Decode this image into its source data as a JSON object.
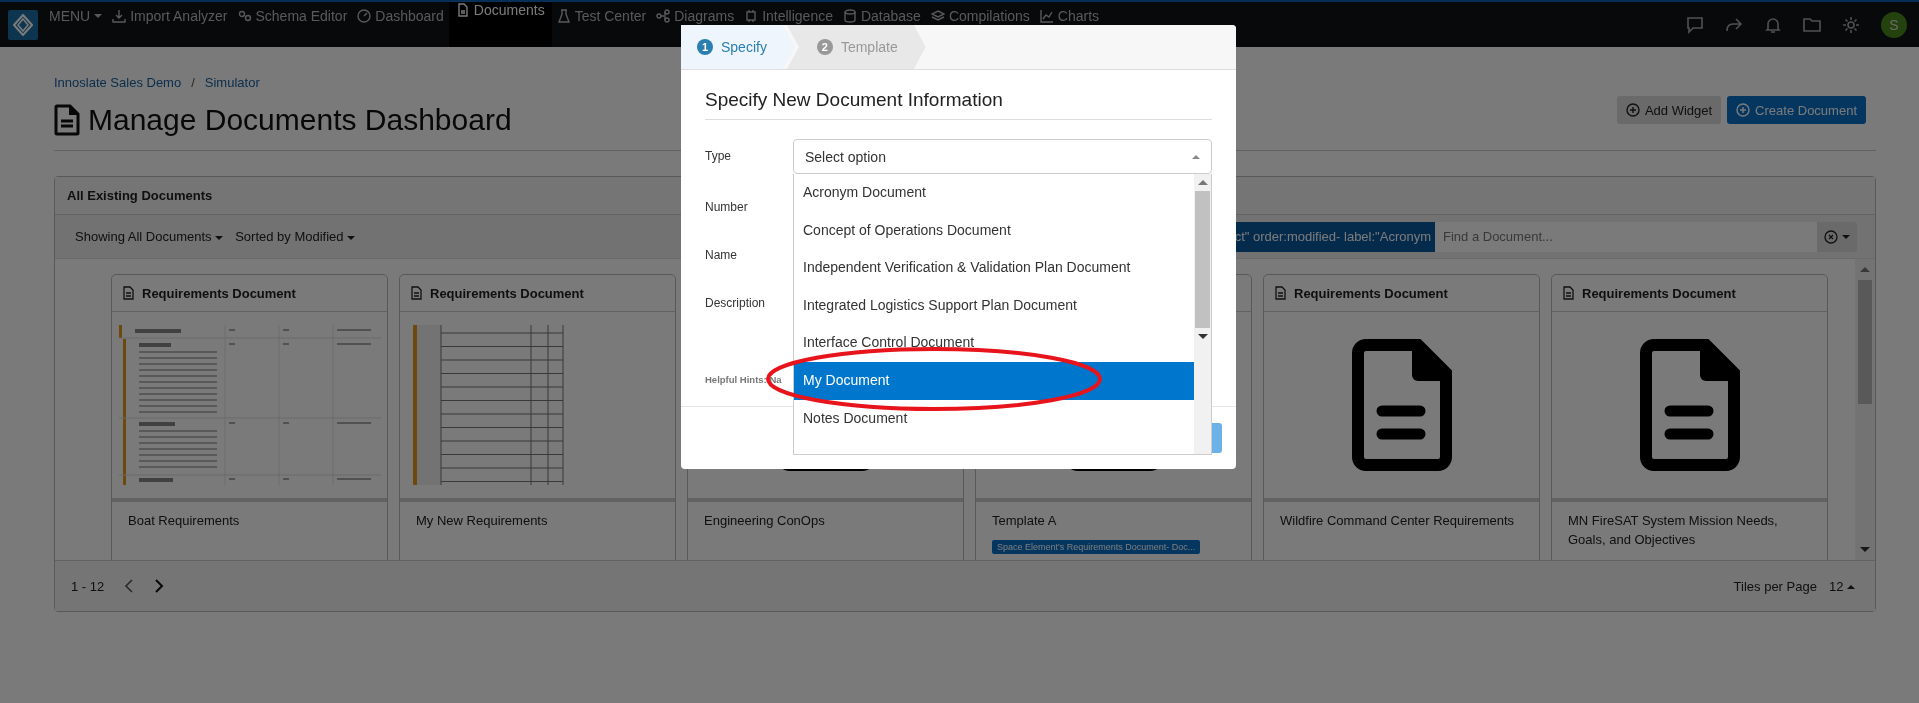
{
  "nav": {
    "menu_label": "MENU",
    "items": [
      {
        "label": "Import Analyzer",
        "selected": false
      },
      {
        "label": "Schema Editor",
        "selected": false
      },
      {
        "label": "Dashboard",
        "selected": false
      },
      {
        "label": "Documents",
        "selected": true
      },
      {
        "label": "Test Center",
        "selected": false
      },
      {
        "label": "Diagrams",
        "selected": false
      },
      {
        "label": "Intelligence",
        "selected": false
      },
      {
        "label": "Database",
        "selected": false
      },
      {
        "label": "Compilations",
        "selected": false
      },
      {
        "label": "Charts",
        "selected": false
      }
    ],
    "avatar": "S"
  },
  "breadcrumb": {
    "separator": "/",
    "items": [
      "Innoslate Sales Demo",
      "Simulator"
    ]
  },
  "page_title": "Manage Documents Dashboard",
  "actions": [
    {
      "label": "Add Widget",
      "kind": "secondary"
    },
    {
      "label": "Create Document",
      "kind": "primary"
    }
  ],
  "panel": {
    "title": "All Existing Documents",
    "filters": [
      "Showing All Documents",
      "Sorted by Modified"
    ],
    "search": {
      "tag": "ct\" order:modified- label:\"Acronym",
      "placeholder": "Find a Document..."
    },
    "cards": [
      {
        "header": "Requirements Document",
        "kind": "text",
        "name": "Boat Requirements"
      },
      {
        "header": "Requirements Document",
        "kind": "grid",
        "name": "My New Requirements"
      },
      {
        "kind": "icon",
        "name": "Engineering ConOps"
      },
      {
        "kind": "icon",
        "name": "Template A",
        "tags": [
          "Space Element's Requirements Document- Doc..."
        ]
      },
      {
        "header": "Requirements Document",
        "kind": "icon",
        "name": "Wildfire Command Center Requirements"
      },
      {
        "header": "Requirements Document",
        "kind": "icon",
        "name": "MN FireSAT System Mission Needs, Goals, and Objectives"
      }
    ],
    "range": "1 - 12",
    "tiles_label": "Tiles per Page",
    "tiles_value": "12"
  },
  "dialog": {
    "steps": [
      {
        "number": "1",
        "label": "Specify",
        "selected": true
      },
      {
        "number": "2",
        "label": "Template",
        "selected": false
      }
    ],
    "title": "Specify New Document Information",
    "fields": [
      "Type",
      "Number",
      "Name",
      "Description"
    ],
    "hint": "Helpful Hints: Na",
    "select": {
      "placeholder": "Select option",
      "expanded": true,
      "options": [
        {
          "label": "Acronym Document",
          "selected": false
        },
        {
          "label": "Concept of Operations Document",
          "selected": false
        },
        {
          "label": "Independent Verification & Validation Plan Document",
          "selected": false
        },
        {
          "label": "Integrated Logistics Support Plan Document",
          "selected": false
        },
        {
          "label": "Interface Control Document",
          "selected": false
        },
        {
          "label": "My Document",
          "selected": true
        },
        {
          "label": "Notes Document",
          "selected": false
        }
      ]
    }
  }
}
